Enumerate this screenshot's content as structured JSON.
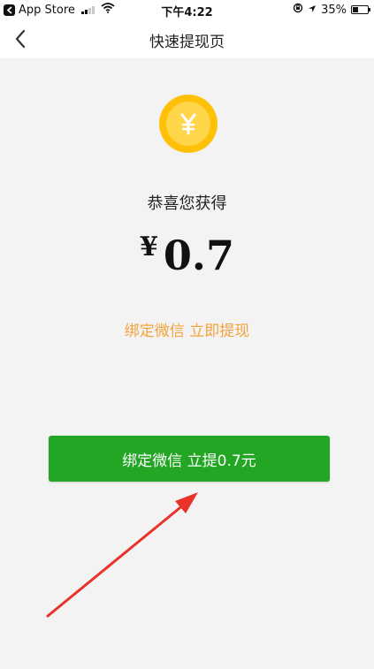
{
  "status_bar": {
    "carrier": "App Store",
    "time": "下午4:22",
    "battery": "35%",
    "battery_level": 0.35
  },
  "nav": {
    "title": "快速提现页"
  },
  "main": {
    "congrats": "恭喜您获得",
    "currency": "¥",
    "amount": "0.7",
    "bind_link": "绑定微信 立即提现",
    "withdraw_button": "绑定微信 立提0.7元"
  },
  "colors": {
    "accent_green": "#22a624",
    "link_orange": "#f3a33c",
    "coin_gold": "#ffc107",
    "arrow_red": "#e8322a"
  },
  "icons": {
    "back": "chevron-left-icon",
    "coin": "yuan-coin-icon",
    "annotation": "red-arrow-annotation"
  }
}
